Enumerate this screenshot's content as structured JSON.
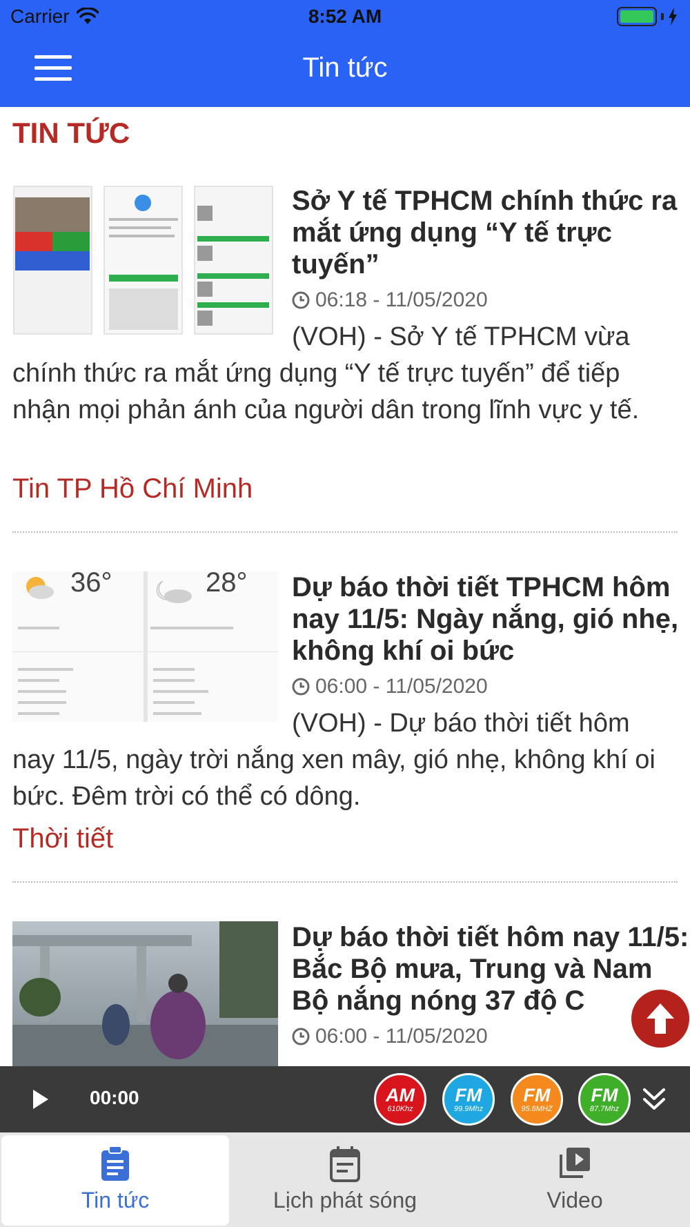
{
  "status_bar": {
    "carrier": "Carrier",
    "time": "8:52 AM"
  },
  "nav": {
    "title": "Tin tức"
  },
  "section_title": "TIN TỨC",
  "articles": [
    {
      "headline": "Sở Y tế TPHCM chính thức ra mắt ứng dụng “Y tế trực tuyến”",
      "time": "06:18 - 11/05/2020",
      "summary": "(VOH) - Sở Y tế TPHCM vừa chính thức ra mắt ứng dụng “Y tế trực tuyến” để tiếp nhận mọi phản ánh của người dân trong lĩnh vực y tế.",
      "category": "Tin TP Hồ Chí Minh"
    },
    {
      "headline": "Dự báo thời tiết TPHCM hôm nay 11/5: Ngày nắng, gió nhẹ, không khí oi bức",
      "time": "06:00 - 11/05/2020",
      "summary": "(VOH) - Dự báo thời tiết hôm nay 11/5, ngày trời nắng xen mây, gió nhẹ, không khí oi bức. Đêm trời có thể có dông.",
      "category": "Thời tiết",
      "thumb_temps": [
        "36°",
        "28°"
      ]
    },
    {
      "headline": "Dự báo thời tiết hôm nay 11/5: Bắc Bộ mưa, Trung và Nam Bộ nắng nóng 37 độ C",
      "time": "06:00 - 11/05/2020"
    }
  ],
  "player": {
    "time": "00:00",
    "stations": [
      {
        "band": "AM",
        "freq": "610Khz",
        "color": "#d8141c"
      },
      {
        "band": "FM",
        "freq": "99.9Mhz",
        "color": "#1ea7e0"
      },
      {
        "band": "FM",
        "freq": "95.6MHZ",
        "color": "#f48a1e"
      },
      {
        "band": "FM",
        "freq": "87.7Mhz",
        "color": "#3fae29"
      }
    ]
  },
  "tabs": [
    {
      "label": "Tin tức",
      "icon": "clipboard-icon",
      "active": true
    },
    {
      "label": "Lịch phát sóng",
      "icon": "calendar-icon",
      "active": false
    },
    {
      "label": "Video",
      "icon": "video-icon",
      "active": false
    }
  ],
  "colors": {
    "nav_blue": "#2a62f6",
    "accent_red": "#b52a25",
    "tab_active": "#3b6fd8"
  }
}
